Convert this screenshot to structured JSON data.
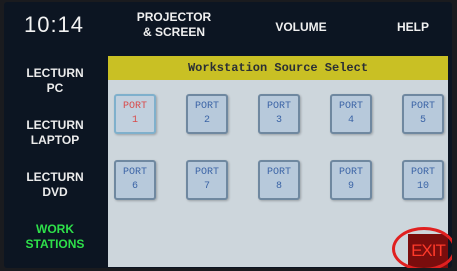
{
  "clock": "10:14",
  "top_nav": {
    "projector": "PROJECTOR\n& SCREEN",
    "projector_line1": "PROJECTOR",
    "projector_line2": "& SCREEN",
    "volume": "VOLUME",
    "help": "HELP"
  },
  "sidebar": {
    "items": [
      {
        "line1": "LECTURN",
        "line2": "PC",
        "active": false
      },
      {
        "line1": "LECTURN",
        "line2": "LAPTOP",
        "active": false
      },
      {
        "line1": "LECTURN",
        "line2": "DVD",
        "active": false
      },
      {
        "line1": "WORK",
        "line2": "STATIONS",
        "active": true
      }
    ]
  },
  "panel": {
    "title": "Workstation Source Select",
    "port_label": "PORT",
    "ports": [
      "1",
      "2",
      "3",
      "4",
      "5",
      "6",
      "7",
      "8",
      "9",
      "10"
    ],
    "selected_port": "1"
  },
  "exit_label": "EXIT",
  "colors": {
    "header_yellow": "#c9c024",
    "selected_text": "#d94a4a",
    "port_text": "#3b64a6",
    "active_side": "#2ee04a",
    "exit_red": "#ff3a2a"
  }
}
